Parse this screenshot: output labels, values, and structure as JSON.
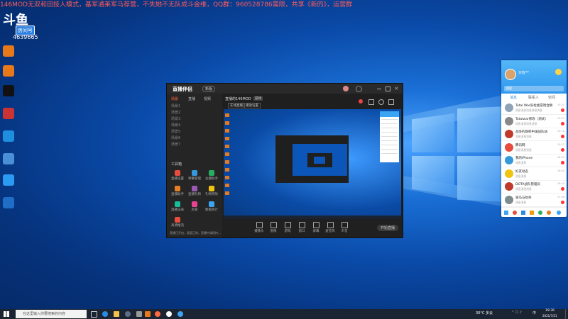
{
  "stream_banner": "146MOD无双和田技人模式，基军通莱军马荐营，不失她不无队成斗金维，QQ群：960528786需限，共享《新的》，运营群",
  "douyu": {
    "logo": "斗鱼",
    "badge": "房间号",
    "room_id": "4639665"
  },
  "desktop_icons": [
    {
      "label": "",
      "color": "#e8791a"
    },
    {
      "label": "",
      "color": "#e8791a"
    },
    {
      "label": "",
      "color": "#111111"
    },
    {
      "label": "",
      "color": "#cc3333"
    },
    {
      "label": "",
      "color": "#1e8fe0"
    },
    {
      "label": "",
      "color": "#4a90d9"
    },
    {
      "label": "",
      "color": "#2b9af3"
    },
    {
      "label": "",
      "color": "#1e6ec8"
    }
  ],
  "stream_app": {
    "brand": "直播伴侣",
    "brand_pill": "新版",
    "tabs": [
      "场景",
      "直播",
      "视频"
    ],
    "active_tab": "场景",
    "scenes": [
      "场景1",
      "场景2",
      "场景3",
      "场景4",
      "场景5",
      "场景6",
      "场景7"
    ],
    "tools_title": "工具箱",
    "tools": [
      "直播设置",
      "弹幕管理",
      "主播助手",
      "直播助手",
      "直播礼物",
      "礼物特效",
      "直播记录",
      "房管",
      "数据统计",
      "高清推流"
    ],
    "room_title": "直播的146MOD",
    "room_tag": "游戏",
    "room_tabs": [
      "在线直播",
      "播放设置"
    ],
    "controls": [
      "摄像头",
      "图像",
      "游戏",
      "窗口",
      "屏幕",
      "麦克风",
      "声音"
    ],
    "go_live": "开始直播",
    "footer_note": "直播已开启，画面正常，直播中请保持..."
  },
  "qq": {
    "user_name": "只有**",
    "search_placeholder": "搜索",
    "tabs": [
      "消息",
      "联系人",
      "空间"
    ],
    "active_tab": "消息",
    "chats": [
      {
        "name": "Total War旧拉拢游戏合群",
        "msg": "消息消息消息消息消息",
        "time": "19:21",
        "color": "#8fa3b8",
        "badge": true
      },
      {
        "name": "Totalwar修改（测式）",
        "msg": "消息消息消息消息",
        "time": "19:20",
        "color": "#888888",
        "badge": true
      },
      {
        "name": "战争的旗帜中国战队站",
        "msg": "消息消息消息",
        "time": "19:18",
        "color": "#c0392b",
        "badge": true
      },
      {
        "name": "腾讯网",
        "msg": "消息消息消息",
        "time": "19:12",
        "color": "#e74c3c",
        "badge": true
      },
      {
        "name": "我的iPhone",
        "msg": "消息消息",
        "time": "18:50",
        "color": "#3498db",
        "badge": true
      },
      {
        "name": "好友动态",
        "msg": "消息消息",
        "time": "18:40",
        "color": "#f1c40f",
        "badge": false
      },
      {
        "name": "DOTA战队管理员",
        "msg": "消息消息消息",
        "time": "18:20",
        "color": "#c0392b",
        "badge": true
      },
      {
        "name": "骑马与砍杀",
        "msg": "消息消息",
        "time": "17:58",
        "color": "#7f8c8d",
        "badge": true
      }
    ]
  },
  "taskbar": {
    "search_placeholder": "在这里输入你要搜索的内容",
    "weather": "30°C 多云",
    "clock_time": "19:36",
    "clock_date": "2021/7/21"
  }
}
